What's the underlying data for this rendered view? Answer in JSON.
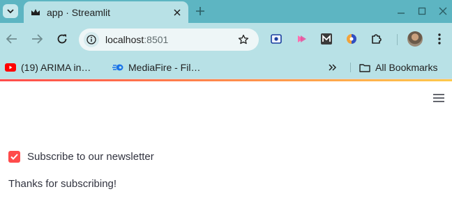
{
  "browser": {
    "tab": {
      "title": "app · Streamlit"
    },
    "address_bar": {
      "host": "localhost",
      "port": ":8501"
    },
    "bookmarks": [
      {
        "label": "(19) ARIMA in…",
        "icon": "youtube-icon"
      },
      {
        "label": "MediaFire - Fil…",
        "icon": "mediafire-icon"
      }
    ],
    "all_bookmarks_label": "All Bookmarks",
    "colors": {
      "tab_strip": "#5db5c2",
      "toolbar": "#b8e1e6"
    }
  },
  "app": {
    "checkbox": {
      "label": "Subscribe to our newsletter",
      "checked": true
    },
    "message": "Thanks for subscribing!",
    "colors": {
      "accent": "#ff4b4b",
      "text": "#31333f"
    }
  }
}
